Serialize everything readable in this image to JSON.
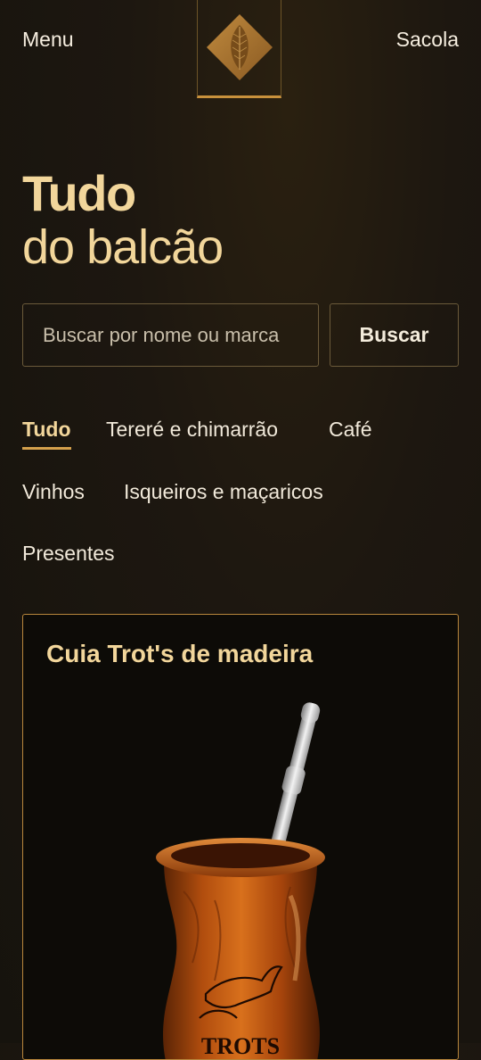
{
  "header": {
    "menu_label": "Menu",
    "bag_label": "Sacola",
    "logo_icon": "tobacco-leaf-diamond-icon"
  },
  "hero": {
    "title_bold": "Tudo",
    "title_light": "do balcão"
  },
  "search": {
    "placeholder": "Buscar por nome ou marca",
    "button_label": "Buscar"
  },
  "categories": [
    {
      "label": "Tudo",
      "active": true
    },
    {
      "label": "Tereré e chimarrão",
      "active": false
    },
    {
      "label": "Café",
      "active": false
    },
    {
      "label": "Vinhos",
      "active": false
    },
    {
      "label": "Isqueiros e maçaricos",
      "active": false
    },
    {
      "label": "Presentes",
      "active": false
    }
  ],
  "products": [
    {
      "title": "Cuia Trot's de madeira",
      "image_text": "TROTS"
    }
  ],
  "colors": {
    "accent": "#f2d69b",
    "border_gold": "#c8913c",
    "background": "#1d1710"
  }
}
